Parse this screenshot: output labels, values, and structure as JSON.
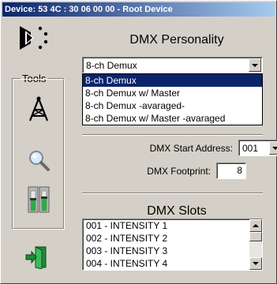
{
  "window": {
    "title": "Device:  53 4C : 30 06 00 00 - Root Device"
  },
  "toolbar": {
    "tools_label": "Tools",
    "icons": [
      "device-logo-icon",
      "antenna-tower-icon",
      "magnifier-icon",
      "level-meters-icon",
      "exit-door-icon"
    ]
  },
  "personality": {
    "heading": "DMX Personality",
    "selected": "8-ch Demux",
    "options": [
      "8-ch Demux",
      "8-ch Demux w/ Master",
      "8-ch Demux -avaraged-",
      "8-ch Demux w/ Master -avaraged"
    ],
    "highlighted_index": 0
  },
  "addressing": {
    "start_label": "DMX Start Address:",
    "start_value": "001",
    "footprint_label": "DMX Footprint:",
    "footprint_value": "8"
  },
  "slots": {
    "heading": "DMX Slots",
    "items": [
      "001 - INTENSITY 1",
      "002 - INTENSITY 2",
      "003 - INTENSITY 3",
      "004 - INTENSITY 4"
    ]
  },
  "colors": {
    "title_start": "#0a246a",
    "title_end": "#a6caf0",
    "selection": "#0a246a",
    "face": "#d4d0c8"
  }
}
